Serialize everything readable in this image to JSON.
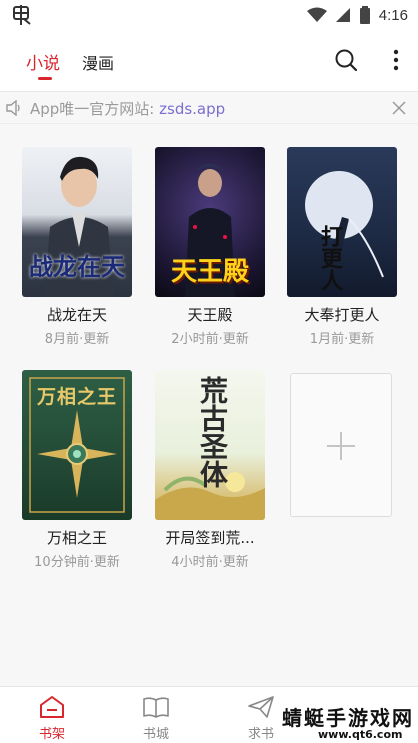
{
  "status_bar": {
    "time": "4:16",
    "app_icon": "bug-icon",
    "icons": [
      "wifi-icon",
      "cellular-signal-icon",
      "battery-icon"
    ]
  },
  "header": {
    "tabs": [
      {
        "label": "小说",
        "active": true
      },
      {
        "label": "漫画",
        "active": false
      }
    ],
    "actions": [
      "search-icon",
      "more-vertical-icon"
    ]
  },
  "notice": {
    "prefix": "App唯一官方网站: ",
    "link": "zsds.app",
    "icon": "speaker-icon"
  },
  "books": [
    {
      "title": "战龙在天",
      "updated": "8月前·更新",
      "cover_text": "战龙在天"
    },
    {
      "title": "天王殿",
      "updated": "2小时前·更新",
      "cover_text": "天王殿"
    },
    {
      "title": "大奉打更人",
      "updated": "1月前·更新",
      "cover_text": "打更人"
    },
    {
      "title": "万相之王",
      "updated": "10分钟前·更新",
      "cover_text": "万相之王"
    },
    {
      "title": "开局签到荒...",
      "updated": "4小时前·更新",
      "cover_text": "荒古圣体"
    }
  ],
  "add_tile": {
    "icon": "plus-icon"
  },
  "bottom_nav": [
    {
      "label": "书架",
      "icon": "bookshelf-icon",
      "active": true
    },
    {
      "label": "书城",
      "icon": "book-open-icon",
      "active": false
    },
    {
      "label": "求书",
      "icon": "paper-plane-icon",
      "active": false
    }
  ],
  "watermark": {
    "title": "蜻蜓手游戏网",
    "url": "www.qt6.com"
  },
  "colors": {
    "accent": "#d9262e",
    "link": "#7a6fd0",
    "muted": "#999999"
  }
}
